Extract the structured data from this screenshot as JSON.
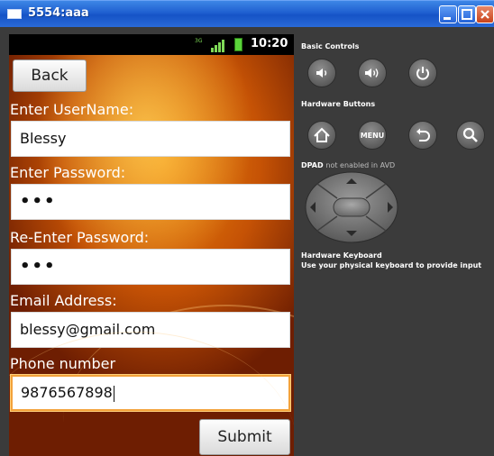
{
  "window": {
    "title": "5554:aaa"
  },
  "statusbar": {
    "data_icon": "3G",
    "time": "10:20"
  },
  "form": {
    "back_label": "Back",
    "username_label": "Enter UserName:",
    "username_value": "Blessy",
    "password_label": "Enter Password:",
    "password_value": "•••",
    "reenter_label": "Re-Enter Password:",
    "reenter_value": "•••",
    "email_label": "Email Address:",
    "email_value": "blessy@gmail.com",
    "phone_label": "Phone number",
    "phone_value": "9876567898",
    "submit_label": "Submit"
  },
  "panel": {
    "basic_controls": "Basic Controls",
    "basic_icons": [
      "volume-down-icon",
      "volume-up-icon",
      "power-icon"
    ],
    "hardware_buttons": "Hardware Buttons",
    "hardware_icons": [
      "home-icon",
      "menu-icon",
      "back-arrow-icon",
      "search-icon"
    ],
    "menu_label": "MENU",
    "dpad_title": "DPAD",
    "dpad_note": "not enabled in AVD",
    "keyboard_title": "Hardware Keyboard",
    "keyboard_note": "Use your physical keyboard to provide input"
  },
  "colors": {
    "titlebar": "#1f5fd0",
    "panel_bg": "#3b3b3b",
    "phone_bg": "#e07a0c",
    "focus_border": "#f3a23a"
  }
}
